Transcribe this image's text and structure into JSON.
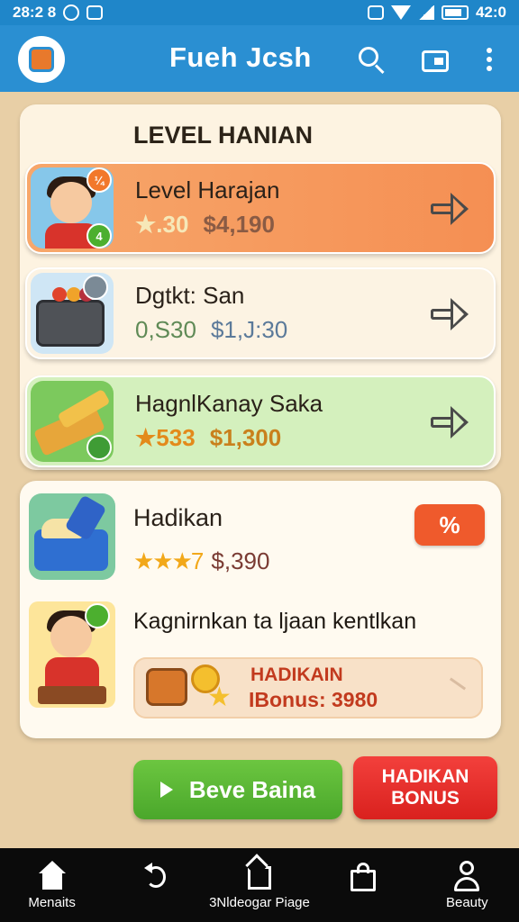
{
  "status_bar": {
    "time": "28:2 8",
    "clock": "42:0"
  },
  "app_bar": {
    "title": "Fueh Jcsh"
  },
  "levels": {
    "heading": "LEVEL HANIAN",
    "items": [
      {
        "title": "Level Harajan",
        "stat_a": "★.30",
        "stat_b": "$4,190",
        "badge_top": "¼",
        "badge_bottom": "4"
      },
      {
        "title": "Dgtkt: San",
        "stat_a": "0,S30",
        "stat_b": "$1,J:30"
      },
      {
        "title": "HagnlKanay Saka",
        "stat_a": "★533",
        "stat_b": "$1,300"
      }
    ]
  },
  "reward": {
    "title": "Hadikan",
    "stars": "★★★7",
    "value": "$,390",
    "badge": "%",
    "message": "Kagnirnkan ta ljaan kentlkan",
    "bonus_label": "HADIKAIN",
    "bonus_value": "IBonus: 3980"
  },
  "buttons": {
    "green": "Beve Baina",
    "red_line1": "HADIKAN",
    "red_line2": "BONUS"
  },
  "bottom_nav": [
    {
      "label": "Menaits"
    },
    {
      "label": ""
    },
    {
      "label": "3Nldeogar Piage"
    },
    {
      "label": ""
    },
    {
      "label": "Beauty"
    }
  ],
  "colors": {
    "app_bar": "#2a8fd2",
    "card_orange": "#f58f53",
    "card_cream": "#fcf3e3",
    "card_green": "#d4f0bd",
    "button_green": "#4aa72b",
    "button_red": "#d9211e"
  }
}
